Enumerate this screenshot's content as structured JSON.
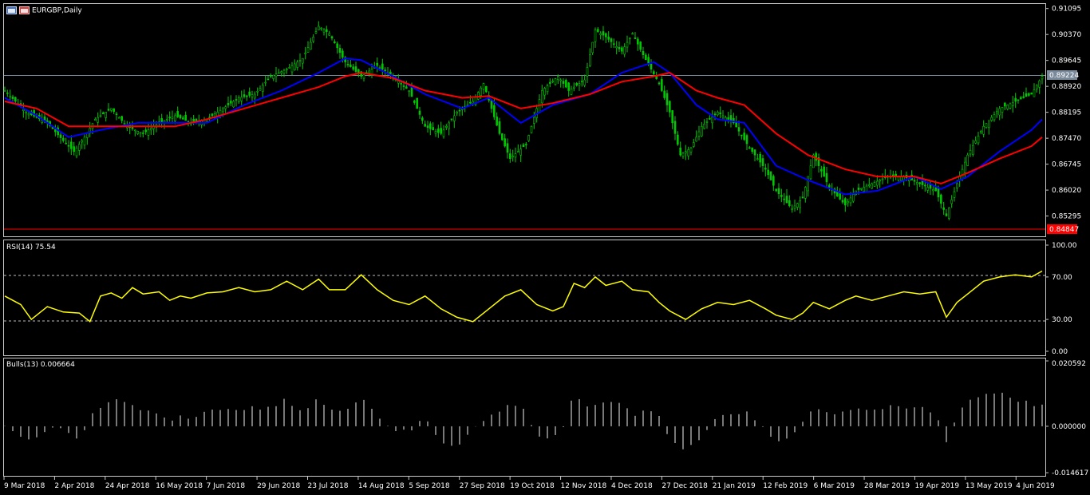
{
  "window": {
    "symbol_title": "EURGBP,Daily"
  },
  "colors": {
    "background": "#000000",
    "candles": "#00c800",
    "ma_fast": "#0000ff",
    "ma_slow": "#ff0000",
    "rsi_line": "#ffff00",
    "bulls_bars": "#c8c8c8",
    "current_price_line": "#7a8a9a",
    "low_line": "#ff0000"
  },
  "panes": {
    "price": {
      "ticks": [
        "0.91095",
        "0.90370",
        "0.89645",
        "0.88920",
        "0.88195",
        "0.87470",
        "0.86745",
        "0.86020",
        "0.85295"
      ],
      "current_price": "0.89224",
      "low_marker": "0.84847"
    },
    "rsi": {
      "label": "RSI(14) 75.54",
      "ticks": [
        "100.00",
        "70.00",
        "30.00",
        "0.00"
      ]
    },
    "bulls": {
      "label": "Bulls(13) 0.006664",
      "ticks": [
        "0.020592",
        "0.000000",
        "-0.014617"
      ]
    }
  },
  "chart_data": {
    "type": "line",
    "title": "EURGBP,Daily",
    "x_labels": [
      "9 Mar 2018",
      "2 Apr 2018",
      "24 Apr 2018",
      "16 May 2018",
      "7 Jun 2018",
      "29 Jun 2018",
      "23 Jul 2018",
      "14 Aug 2018",
      "5 Sep 2018",
      "27 Sep 2018",
      "19 Oct 2018",
      "12 Nov 2018",
      "4 Dec 2018",
      "27 Dec 2018",
      "21 Jan 2019",
      "12 Feb 2019",
      "6 Mar 2019",
      "28 Mar 2019",
      "19 Apr 2019",
      "13 May 2019",
      "4 Jun 2019"
    ],
    "price_ylim": [
      0.8475,
      0.912
    ],
    "price_close": [
      [
        0,
        0.888
      ],
      [
        8,
        0.882
      ],
      [
        16,
        0.879
      ],
      [
        22,
        0.874
      ],
      [
        26,
        0.871
      ],
      [
        30,
        0.875
      ],
      [
        34,
        0.88
      ],
      [
        40,
        0.883
      ],
      [
        46,
        0.878
      ],
      [
        52,
        0.876
      ],
      [
        58,
        0.879
      ],
      [
        64,
        0.881
      ],
      [
        70,
        0.879
      ],
      [
        76,
        0.88
      ],
      [
        82,
        0.883
      ],
      [
        88,
        0.886
      ],
      [
        94,
        0.887
      ],
      [
        100,
        0.892
      ],
      [
        106,
        0.894
      ],
      [
        112,
        0.897
      ],
      [
        118,
        0.906
      ],
      [
        122,
        0.904
      ],
      [
        128,
        0.896
      ],
      [
        134,
        0.892
      ],
      [
        140,
        0.895
      ],
      [
        146,
        0.892
      ],
      [
        152,
        0.888
      ],
      [
        158,
        0.878
      ],
      [
        164,
        0.876
      ],
      [
        170,
        0.882
      ],
      [
        176,
        0.885
      ],
      [
        180,
        0.89
      ],
      [
        186,
        0.876
      ],
      [
        190,
        0.869
      ],
      [
        196,
        0.873
      ],
      [
        202,
        0.888
      ],
      [
        208,
        0.892
      ],
      [
        212,
        0.888
      ],
      [
        218,
        0.891
      ],
      [
        222,
        0.905
      ],
      [
        226,
        0.903
      ],
      [
        232,
        0.899
      ],
      [
        236,
        0.904
      ],
      [
        240,
        0.898
      ],
      [
        246,
        0.89
      ],
      [
        250,
        0.882
      ],
      [
        254,
        0.87
      ],
      [
        258,
        0.872
      ],
      [
        262,
        0.878
      ],
      [
        268,
        0.882
      ],
      [
        274,
        0.879
      ],
      [
        280,
        0.872
      ],
      [
        286,
        0.866
      ],
      [
        290,
        0.86
      ],
      [
        296,
        0.855
      ],
      [
        300,
        0.858
      ],
      [
        304,
        0.87
      ],
      [
        310,
        0.861
      ],
      [
        316,
        0.856
      ],
      [
        320,
        0.86
      ],
      [
        326,
        0.862
      ],
      [
        332,
        0.864
      ],
      [
        338,
        0.864
      ],
      [
        344,
        0.862
      ],
      [
        350,
        0.86
      ],
      [
        354,
        0.853
      ],
      [
        358,
        0.862
      ],
      [
        362,
        0.87
      ],
      [
        368,
        0.878
      ],
      [
        374,
        0.883
      ],
      [
        380,
        0.885
      ],
      [
        386,
        0.887
      ],
      [
        390,
        0.892
      ]
    ],
    "ma_fast": [
      [
        0,
        0.886
      ],
      [
        12,
        0.881
      ],
      [
        24,
        0.875
      ],
      [
        36,
        0.877
      ],
      [
        50,
        0.879
      ],
      [
        64,
        0.879
      ],
      [
        76,
        0.879
      ],
      [
        90,
        0.884
      ],
      [
        104,
        0.888
      ],
      [
        118,
        0.893
      ],
      [
        128,
        0.897
      ],
      [
        134,
        0.8965
      ],
      [
        146,
        0.892
      ],
      [
        158,
        0.887
      ],
      [
        172,
        0.883
      ],
      [
        182,
        0.886
      ],
      [
        194,
        0.879
      ],
      [
        206,
        0.884
      ],
      [
        220,
        0.887
      ],
      [
        232,
        0.893
      ],
      [
        244,
        0.896
      ],
      [
        250,
        0.893
      ],
      [
        260,
        0.884
      ],
      [
        268,
        0.88
      ],
      [
        278,
        0.879
      ],
      [
        290,
        0.867
      ],
      [
        302,
        0.863
      ],
      [
        316,
        0.859
      ],
      [
        328,
        0.86
      ],
      [
        342,
        0.864
      ],
      [
        352,
        0.8605
      ],
      [
        362,
        0.864
      ],
      [
        374,
        0.871
      ],
      [
        386,
        0.877
      ],
      [
        390,
        0.88
      ]
    ],
    "ma_slow": [
      [
        0,
        0.885
      ],
      [
        12,
        0.883
      ],
      [
        24,
        0.878
      ],
      [
        36,
        0.878
      ],
      [
        50,
        0.878
      ],
      [
        64,
        0.878
      ],
      [
        76,
        0.88
      ],
      [
        90,
        0.883
      ],
      [
        104,
        0.886
      ],
      [
        118,
        0.889
      ],
      [
        128,
        0.892
      ],
      [
        134,
        0.893
      ],
      [
        146,
        0.8915
      ],
      [
        158,
        0.888
      ],
      [
        172,
        0.886
      ],
      [
        182,
        0.8865
      ],
      [
        194,
        0.883
      ],
      [
        206,
        0.8845
      ],
      [
        220,
        0.887
      ],
      [
        232,
        0.8905
      ],
      [
        244,
        0.892
      ],
      [
        250,
        0.893
      ],
      [
        260,
        0.888
      ],
      [
        268,
        0.886
      ],
      [
        278,
        0.884
      ],
      [
        290,
        0.876
      ],
      [
        302,
        0.87
      ],
      [
        316,
        0.866
      ],
      [
        328,
        0.864
      ],
      [
        342,
        0.864
      ],
      [
        352,
        0.862
      ],
      [
        362,
        0.865
      ],
      [
        374,
        0.869
      ],
      [
        386,
        0.8725
      ],
      [
        390,
        0.875
      ]
    ],
    "rsi_ylim": [
      0,
      100
    ],
    "rsi": [
      [
        0,
        52
      ],
      [
        6,
        44
      ],
      [
        10,
        30
      ],
      [
        16,
        42
      ],
      [
        22,
        37
      ],
      [
        28,
        36
      ],
      [
        32,
        28
      ],
      [
        36,
        52
      ],
      [
        40,
        55
      ],
      [
        44,
        50
      ],
      [
        48,
        60
      ],
      [
        52,
        54
      ],
      [
        58,
        56
      ],
      [
        62,
        48
      ],
      [
        66,
        52
      ],
      [
        70,
        50
      ],
      [
        76,
        55
      ],
      [
        82,
        56
      ],
      [
        88,
        60
      ],
      [
        94,
        56
      ],
      [
        100,
        58
      ],
      [
        106,
        66
      ],
      [
        112,
        58
      ],
      [
        118,
        68
      ],
      [
        122,
        58
      ],
      [
        128,
        58
      ],
      [
        134,
        72
      ],
      [
        140,
        58
      ],
      [
        146,
        48
      ],
      [
        152,
        44
      ],
      [
        158,
        52
      ],
      [
        164,
        40
      ],
      [
        170,
        32
      ],
      [
        176,
        28
      ],
      [
        182,
        40
      ],
      [
        188,
        52
      ],
      [
        194,
        58
      ],
      [
        200,
        44
      ],
      [
        206,
        38
      ],
      [
        210,
        42
      ],
      [
        214,
        64
      ],
      [
        218,
        60
      ],
      [
        222,
        70
      ],
      [
        226,
        62
      ],
      [
        232,
        66
      ],
      [
        236,
        58
      ],
      [
        242,
        56
      ],
      [
        246,
        46
      ],
      [
        250,
        38
      ],
      [
        256,
        30
      ],
      [
        262,
        40
      ],
      [
        268,
        46
      ],
      [
        274,
        44
      ],
      [
        280,
        48
      ],
      [
        286,
        40
      ],
      [
        290,
        34
      ],
      [
        296,
        30
      ],
      [
        300,
        36
      ],
      [
        304,
        46
      ],
      [
        310,
        40
      ],
      [
        316,
        48
      ],
      [
        320,
        52
      ],
      [
        326,
        48
      ],
      [
        332,
        52
      ],
      [
        338,
        56
      ],
      [
        344,
        54
      ],
      [
        350,
        56
      ],
      [
        354,
        32
      ],
      [
        358,
        46
      ],
      [
        362,
        54
      ],
      [
        368,
        66
      ],
      [
        374,
        70
      ],
      [
        380,
        72
      ],
      [
        386,
        70
      ],
      [
        390,
        75.54
      ]
    ],
    "bulls_ylim": [
      -0.0146,
      0.0206
    ],
    "bulls": [
      [
        0,
        0.0004
      ],
      [
        6,
        -0.003
      ],
      [
        10,
        -0.0045
      ],
      [
        16,
        -0.0005
      ],
      [
        22,
        -0.001
      ],
      [
        28,
        -0.004
      ],
      [
        32,
        0.003
      ],
      [
        36,
        0.0055
      ],
      [
        40,
        0.008
      ],
      [
        44,
        0.0085
      ],
      [
        48,
        0.006
      ],
      [
        52,
        0.005
      ],
      [
        58,
        0.004
      ],
      [
        62,
        0.002
      ],
      [
        66,
        0.0035
      ],
      [
        70,
        0.003
      ],
      [
        76,
        0.005
      ],
      [
        82,
        0.0045
      ],
      [
        88,
        0.006
      ],
      [
        94,
        0.0055
      ],
      [
        100,
        0.0055
      ],
      [
        106,
        0.0085
      ],
      [
        112,
        0.0045
      ],
      [
        118,
        0.009
      ],
      [
        122,
        0.0045
      ],
      [
        128,
        0.0055
      ],
      [
        134,
        0.0095
      ],
      [
        140,
        0.0035
      ],
      [
        146,
        -0.001
      ],
      [
        152,
        -0.002
      ],
      [
        158,
        0.003
      ],
      [
        164,
        -0.005
      ],
      [
        170,
        -0.006
      ],
      [
        176,
        -0.001
      ],
      [
        182,
        0.003
      ],
      [
        188,
        0.006
      ],
      [
        194,
        0.0075
      ],
      [
        200,
        -0.003
      ],
      [
        206,
        -0.004
      ],
      [
        210,
        -0.001
      ],
      [
        214,
        0.0105
      ],
      [
        218,
        0.007
      ],
      [
        222,
        0.006
      ],
      [
        226,
        0.008
      ],
      [
        232,
        0.0075
      ],
      [
        236,
        0.0035
      ],
      [
        242,
        0.006
      ],
      [
        246,
        0.003
      ],
      [
        250,
        -0.004
      ],
      [
        256,
        -0.008
      ],
      [
        262,
        -0.003
      ],
      [
        268,
        0.004
      ],
      [
        274,
        0.003
      ],
      [
        280,
        0.0045
      ],
      [
        286,
        -0.002
      ],
      [
        290,
        -0.005
      ],
      [
        296,
        -0.003
      ],
      [
        300,
        0.002
      ],
      [
        304,
        0.006
      ],
      [
        310,
        0.004
      ],
      [
        316,
        0.005
      ],
      [
        320,
        0.006
      ],
      [
        326,
        0.005
      ],
      [
        332,
        0.006
      ],
      [
        338,
        0.0055
      ],
      [
        344,
        0.006
      ],
      [
        350,
        0.004
      ],
      [
        354,
        -0.005
      ],
      [
        358,
        0.004
      ],
      [
        362,
        0.008
      ],
      [
        368,
        0.01
      ],
      [
        374,
        0.011
      ],
      [
        380,
        0.0085
      ],
      [
        386,
        0.007
      ],
      [
        390,
        0.0067
      ]
    ]
  }
}
